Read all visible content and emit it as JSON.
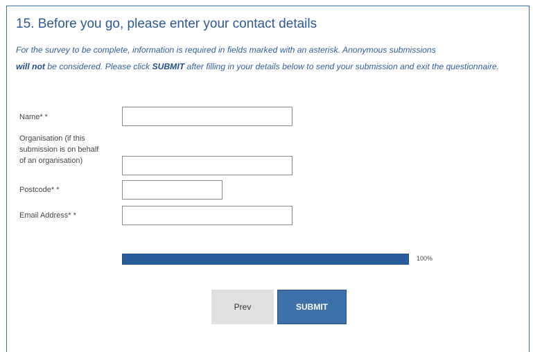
{
  "question": {
    "title": "15. Before you go, please enter your contact details",
    "intro_part1": "For the survey to be complete, information is required in fields marked with an asterisk. Anonymous submissions",
    "intro_bold1": "will not",
    "intro_part2": " be considered.  Please click ",
    "intro_bold2": "SUBMIT",
    "intro_part3": " after filling in your details below to send your submission and exit the questionnaire."
  },
  "form": {
    "name_label": "Name* *",
    "name_value": "",
    "org_label_line1": "Organisation (if this",
    "org_label_line2": "submission is on behalf",
    "org_label_line3": "of an organisation)",
    "org_value": "",
    "postcode_label": "Postcode* *",
    "postcode_value": "",
    "email_label": "Email Address* *",
    "email_value": ""
  },
  "progress": {
    "value": 1.0,
    "text": "100%"
  },
  "buttons": {
    "prev_label": "Prev",
    "submit_label": "SUBMIT"
  },
  "colors": {
    "accent": "#3d6fa8",
    "title": "#2a5a93",
    "progress_fill": "#285c9a"
  }
}
